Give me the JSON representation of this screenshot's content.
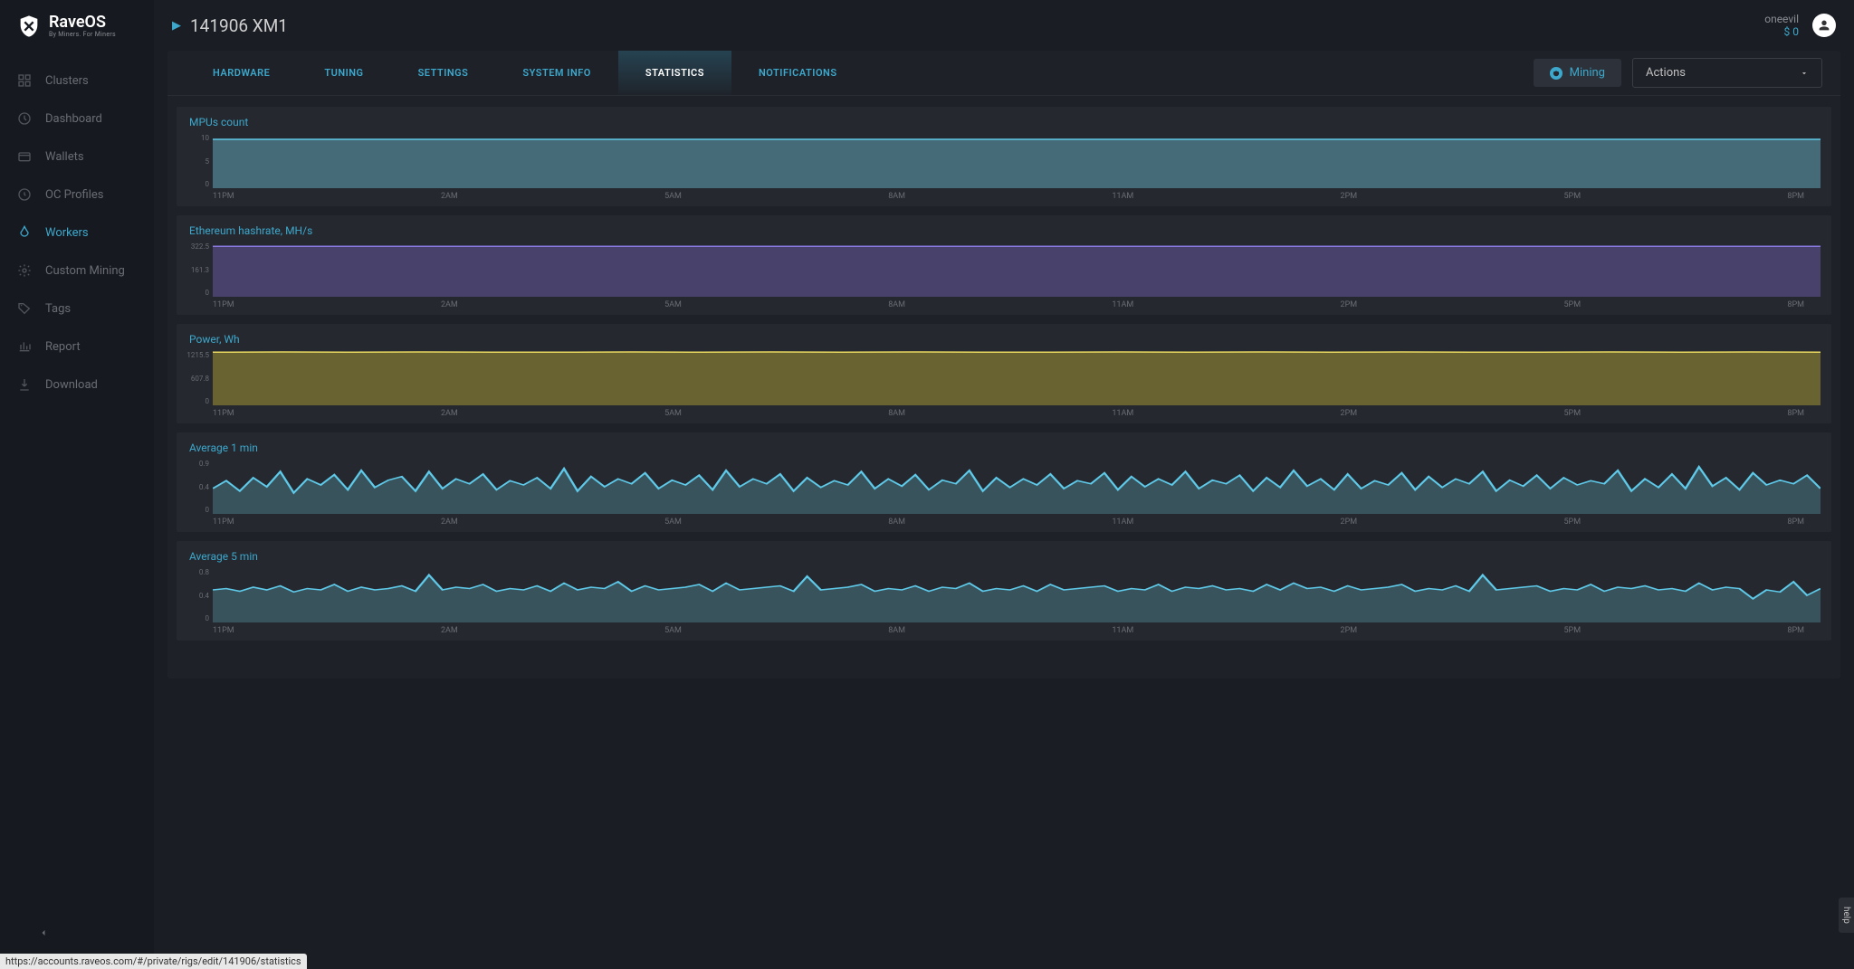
{
  "brand": {
    "name": "RaveOS",
    "sub": "By Miners. For Miners"
  },
  "sidebar": {
    "items": [
      {
        "label": "Clusters"
      },
      {
        "label": "Dashboard"
      },
      {
        "label": "Wallets"
      },
      {
        "label": "OC Profiles"
      },
      {
        "label": "Workers"
      },
      {
        "label": "Custom Mining"
      },
      {
        "label": "Tags"
      },
      {
        "label": "Report"
      },
      {
        "label": "Download"
      }
    ]
  },
  "header": {
    "worker": "141906 XM1"
  },
  "user": {
    "name": "oneevil",
    "balance": "$ 0"
  },
  "tabs": {
    "items": [
      {
        "label": "HARDWARE"
      },
      {
        "label": "TUNING"
      },
      {
        "label": "SETTINGS"
      },
      {
        "label": "SYSTEM INFO"
      },
      {
        "label": "STATISTICS"
      },
      {
        "label": "NOTIFICATIONS"
      }
    ]
  },
  "controls": {
    "mining": "Mining",
    "actions": "Actions"
  },
  "status_url": "https://accounts.raveos.com/#/private/rigs/edit/141906/statistics",
  "help": "help",
  "chart_data": [
    {
      "type": "area",
      "title": "MPUs count",
      "color_line": "#5ec9e8",
      "color_fill": "rgba(94,162,178,0.55)",
      "x_labels": [
        "11PM",
        "2AM",
        "5AM",
        "8AM",
        "11AM",
        "2PM",
        "5PM",
        "8PM"
      ],
      "y_ticks": [
        "10",
        "5",
        "0"
      ],
      "ylim": [
        0,
        10
      ],
      "values": [
        9,
        9,
        9,
        9,
        9,
        9,
        9,
        9,
        9,
        9,
        9,
        9,
        9,
        9,
        9,
        9,
        9,
        9,
        9,
        9,
        9,
        9,
        9,
        9
      ]
    },
    {
      "type": "area",
      "title": "Ethereum hashrate, MH/s",
      "color_line": "#8a7ae0",
      "color_fill": "rgba(90,78,140,0.65)",
      "x_labels": [
        "11PM",
        "2AM",
        "5AM",
        "8AM",
        "11AM",
        "2PM",
        "5PM",
        "8PM"
      ],
      "y_ticks": [
        "322.5",
        "161.3",
        "0"
      ],
      "ylim": [
        0,
        322.5
      ],
      "values": [
        300,
        300,
        300,
        300,
        300,
        300,
        300,
        300,
        300,
        300,
        300,
        300,
        300,
        300,
        300,
        300,
        300,
        300,
        300,
        300,
        300,
        300,
        300,
        300
      ]
    },
    {
      "type": "area",
      "title": "Power, Wh",
      "color_line": "#e8d860",
      "color_fill": "rgba(140,130,50,0.65)",
      "x_labels": [
        "11PM",
        "2AM",
        "5AM",
        "8AM",
        "11AM",
        "2PM",
        "5PM",
        "8PM"
      ],
      "y_ticks": [
        "1215.5",
        "607.8",
        "0"
      ],
      "ylim": [
        0,
        1215.5
      ],
      "values": [
        1190,
        1195,
        1190,
        1195,
        1190,
        1190,
        1195,
        1190,
        1195,
        1190,
        1195,
        1190,
        1190,
        1195,
        1190,
        1195,
        1190,
        1195,
        1190,
        1190,
        1195,
        1190,
        1195,
        1190
      ]
    },
    {
      "type": "area",
      "title": "Average 1 min",
      "color_line": "#5ec9e8",
      "color_fill": "rgba(94,162,178,0.35)",
      "x_labels": [
        "11PM",
        "2AM",
        "5AM",
        "8AM",
        "11AM",
        "2PM",
        "5PM",
        "8PM"
      ],
      "y_ticks": [
        "0.9",
        "0.4",
        "0"
      ],
      "ylim": [
        0,
        0.9
      ],
      "values": [
        0.42,
        0.55,
        0.38,
        0.6,
        0.45,
        0.7,
        0.35,
        0.58,
        0.48,
        0.65,
        0.4,
        0.72,
        0.44,
        0.56,
        0.62,
        0.38,
        0.7,
        0.42,
        0.58,
        0.5,
        0.66,
        0.4,
        0.55,
        0.48,
        0.6,
        0.42,
        0.75,
        0.38,
        0.62,
        0.45,
        0.58,
        0.5,
        0.68,
        0.42,
        0.56,
        0.48,
        0.64,
        0.4,
        0.72,
        0.45,
        0.58,
        0.5,
        0.66,
        0.38,
        0.6,
        0.44,
        0.55,
        0.48,
        0.7,
        0.42,
        0.58,
        0.46,
        0.65,
        0.4,
        0.56,
        0.5,
        0.72,
        0.38,
        0.6,
        0.44,
        0.58,
        0.48,
        0.66,
        0.42,
        0.55,
        0.5,
        0.68,
        0.4,
        0.62,
        0.45,
        0.58,
        0.48,
        0.7,
        0.42,
        0.56,
        0.5,
        0.64,
        0.38,
        0.6,
        0.44,
        0.72,
        0.46,
        0.58,
        0.4,
        0.66,
        0.42,
        0.55,
        0.48,
        0.68,
        0.4,
        0.62,
        0.44,
        0.58,
        0.5,
        0.7,
        0.38,
        0.56,
        0.46,
        0.64,
        0.42,
        0.6,
        0.48,
        0.55,
        0.5,
        0.72,
        0.38,
        0.58,
        0.44,
        0.66,
        0.42,
        0.78,
        0.46,
        0.6,
        0.4,
        0.68,
        0.48,
        0.56,
        0.5,
        0.64,
        0.42
      ]
    },
    {
      "type": "area",
      "title": "Average 5 min",
      "color_line": "#5ec9e8",
      "color_fill": "rgba(94,162,178,0.35)",
      "x_labels": [
        "11PM",
        "2AM",
        "5AM",
        "8AM",
        "11AM",
        "2PM",
        "5PM",
        "8PM"
      ],
      "y_ticks": [
        "0.8",
        "0.4",
        "0"
      ],
      "ylim": [
        0,
        0.8
      ],
      "values": [
        0.48,
        0.5,
        0.46,
        0.52,
        0.48,
        0.54,
        0.45,
        0.5,
        0.48,
        0.56,
        0.46,
        0.52,
        0.48,
        0.5,
        0.54,
        0.46,
        0.7,
        0.48,
        0.52,
        0.5,
        0.56,
        0.46,
        0.5,
        0.48,
        0.54,
        0.46,
        0.58,
        0.48,
        0.52,
        0.5,
        0.6,
        0.46,
        0.54,
        0.48,
        0.5,
        0.52,
        0.56,
        0.46,
        0.58,
        0.48,
        0.5,
        0.52,
        0.54,
        0.46,
        0.68,
        0.48,
        0.5,
        0.52,
        0.56,
        0.46,
        0.5,
        0.48,
        0.54,
        0.46,
        0.52,
        0.5,
        0.58,
        0.46,
        0.5,
        0.48,
        0.54,
        0.46,
        0.56,
        0.48,
        0.5,
        0.52,
        0.54,
        0.46,
        0.5,
        0.48,
        0.56,
        0.46,
        0.52,
        0.5,
        0.54,
        0.48,
        0.5,
        0.46,
        0.56,
        0.48,
        0.58,
        0.5,
        0.52,
        0.46,
        0.54,
        0.48,
        0.5,
        0.52,
        0.56,
        0.46,
        0.5,
        0.48,
        0.54,
        0.46,
        0.7,
        0.48,
        0.5,
        0.52,
        0.54,
        0.46,
        0.5,
        0.48,
        0.56,
        0.46,
        0.52,
        0.5,
        0.54,
        0.48,
        0.5,
        0.46,
        0.58,
        0.48,
        0.52,
        0.5,
        0.35,
        0.48,
        0.45,
        0.6,
        0.4,
        0.5
      ]
    }
  ]
}
